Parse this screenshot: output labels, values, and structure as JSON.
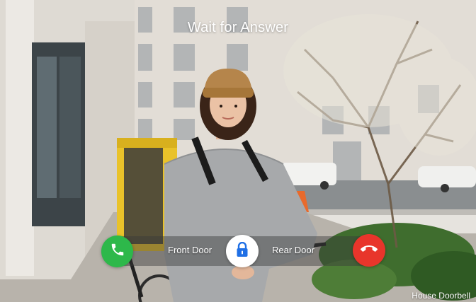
{
  "screen": {
    "title": "Wait for Answer",
    "footer_label": "House Doorbell"
  },
  "controls": {
    "answer": {
      "icon": "phone-icon",
      "color": "#2db84a"
    },
    "front_door_label": "Front Door",
    "unlock": {
      "icon": "lock-icon",
      "color": "#1f6fe5"
    },
    "rear_door_label": "Rear Door",
    "hangup": {
      "icon": "phone-hangup-icon",
      "color": "#e8352b"
    }
  }
}
